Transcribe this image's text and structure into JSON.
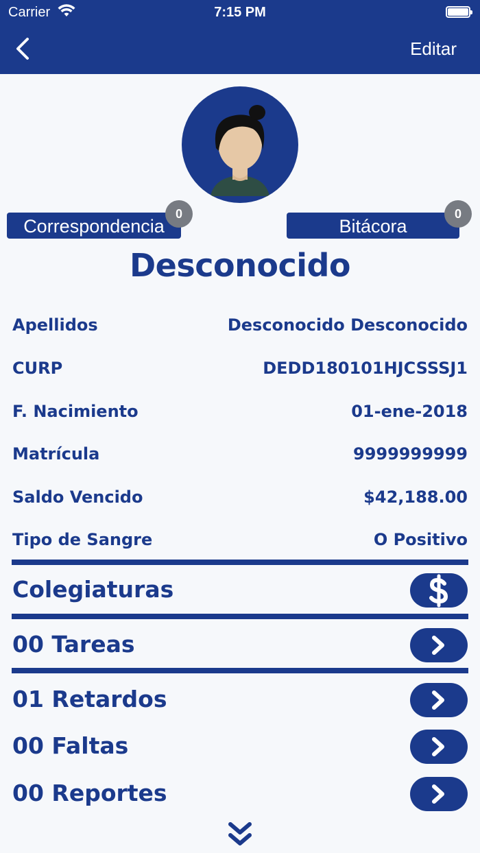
{
  "status_bar": {
    "carrier": "Carrier",
    "time": "7:15 PM"
  },
  "header": {
    "edit_label": "Editar"
  },
  "buttons": {
    "correspondencia_label": "Correspondencia",
    "correspondencia_count": "0",
    "bitacora_label": "Bitácora",
    "bitacora_count": "0"
  },
  "student": {
    "name": "Desconocido"
  },
  "info": [
    {
      "label": "Apellidos",
      "value": "Desconocido Desconocido"
    },
    {
      "label": "CURP",
      "value": "DEDD180101HJCSSSJ1"
    },
    {
      "label": "F. Nacimiento",
      "value": "01-ene-2018"
    },
    {
      "label": "Matrícula",
      "value": "9999999999"
    },
    {
      "label": "Saldo Vencido",
      "value": "$42,188.00"
    },
    {
      "label": "Tipo de Sangre",
      "value": "O Positivo"
    }
  ],
  "sections": [
    {
      "title": "Colegiaturas",
      "icon": "dollar-icon"
    },
    {
      "title": "00 Tareas",
      "icon": "chevron-right-icon"
    },
    {
      "title": "01 Retardos",
      "icon": "chevron-right-icon"
    },
    {
      "title": "00 Faltas",
      "icon": "chevron-right-icon"
    },
    {
      "title": "00 Reportes",
      "icon": "chevron-right-icon"
    }
  ],
  "colors": {
    "primary": "#1b3a8c",
    "background": "#f6f8fb",
    "badge": "#777b82"
  }
}
